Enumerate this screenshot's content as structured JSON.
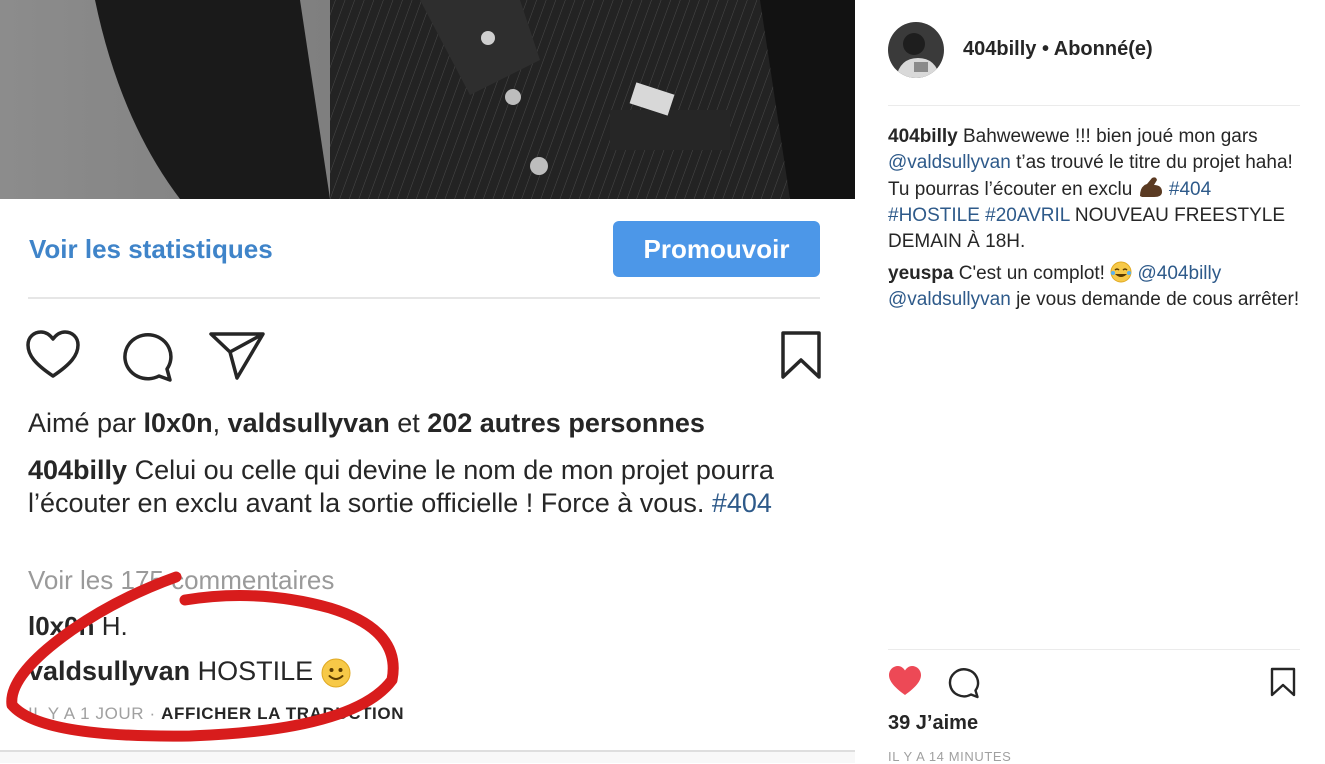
{
  "left_post": {
    "stats_link": "Voir les statistiques",
    "promote_button": "Promouvoir",
    "likes": {
      "prefix": "Aimé par ",
      "user1": "l0x0n",
      "sep": ", ",
      "user2": "valdsullyvan",
      "conj": " et ",
      "others": "202 autres personnes"
    },
    "caption": {
      "user": "404billy",
      "text": " Celui ou celle qui devine le nom de mon projet pourra l’écouter en exclu avant la sortie officielle ! Force à vous. ",
      "hashtag": "#404"
    },
    "view_comments": "Voir les 175 commentaires",
    "comments": [
      {
        "user": "l0x0n",
        "text": " H."
      },
      {
        "user": "valdsullyvan",
        "text": " HOSTILE "
      }
    ],
    "meta": {
      "time": "IL Y A 1 JOUR",
      "dot": " · ",
      "translate": "AFFICHER LA TRADUCTION"
    }
  },
  "right_panel": {
    "header": {
      "username": "404billy",
      "status": " • Abonné(e)"
    },
    "comments": [
      {
        "user": "404billy",
        "t1": " Bahwewewe !!! bien joué mon gars ",
        "mention": "@valdsullyvan",
        "t2": " t’as trouvé le titre du projet haha! Tu pourras l’écouter en exclu ",
        "emoji": "flexed-biceps",
        "h1": "#404",
        "h2": "#HOSTILE",
        "h3": "#20AVRIL",
        "t3": " NOUVEAU FREESTYLE DEMAIN À 18H."
      },
      {
        "user": "yeuspa",
        "t1": " C'est un complot! ",
        "emoji": "tears-of-joy",
        "m1": "@404billy",
        "m2": "@valdsullyvan",
        "t2": " je vous demande de cous arrêter!"
      }
    ],
    "likes": "39 J’aime",
    "timestamp": "IL Y A 14 MINUTES"
  },
  "colors": {
    "link_blue": "#3f84c9",
    "button_blue": "#4c97e8",
    "hashtag": "#2e5a8a",
    "heart_red": "#ed4956",
    "annotation_red": "#d81c1c",
    "muted": "#9a9a9a"
  },
  "icons": [
    "heart-outline-icon",
    "comment-icon",
    "share-icon",
    "bookmark-icon",
    "heart-filled-icon",
    "smile-emoji",
    "flexed-biceps-emoji",
    "tears-of-joy-emoji"
  ]
}
